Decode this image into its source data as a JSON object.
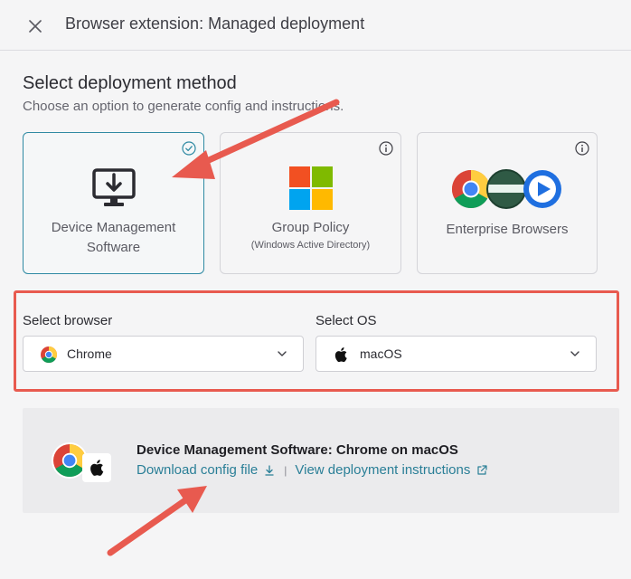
{
  "header": {
    "title": "Browser extension: Managed deployment"
  },
  "section": {
    "title": "Select deployment method",
    "subtitle": "Choose an option to generate config and instructions."
  },
  "cards": [
    {
      "label_line1": "Device Management",
      "label_line2": "Software",
      "selected": true,
      "corner_icon": "checkmark-icon"
    },
    {
      "label_line1": "Group Policy",
      "sublabel": "(Windows Active Directory)",
      "selected": false,
      "corner_icon": "info-icon"
    },
    {
      "label_line1": "Enterprise Browsers",
      "selected": false,
      "corner_icon": "info-icon"
    }
  ],
  "browser_select": {
    "label": "Select browser",
    "value": "Chrome",
    "icon": "chrome-icon"
  },
  "os_select": {
    "label": "Select OS",
    "value": "macOS",
    "icon": "apple-icon"
  },
  "result": {
    "title": "Device Management Software: Chrome on macOS",
    "download_link": "Download config file",
    "separator": "|",
    "instructions_link": "View deployment instructions"
  },
  "colors": {
    "accent": "#2a7f97",
    "selected_border": "#2f8aa3",
    "annotation": "#e85a4f",
    "background": "#f5f5f6"
  }
}
